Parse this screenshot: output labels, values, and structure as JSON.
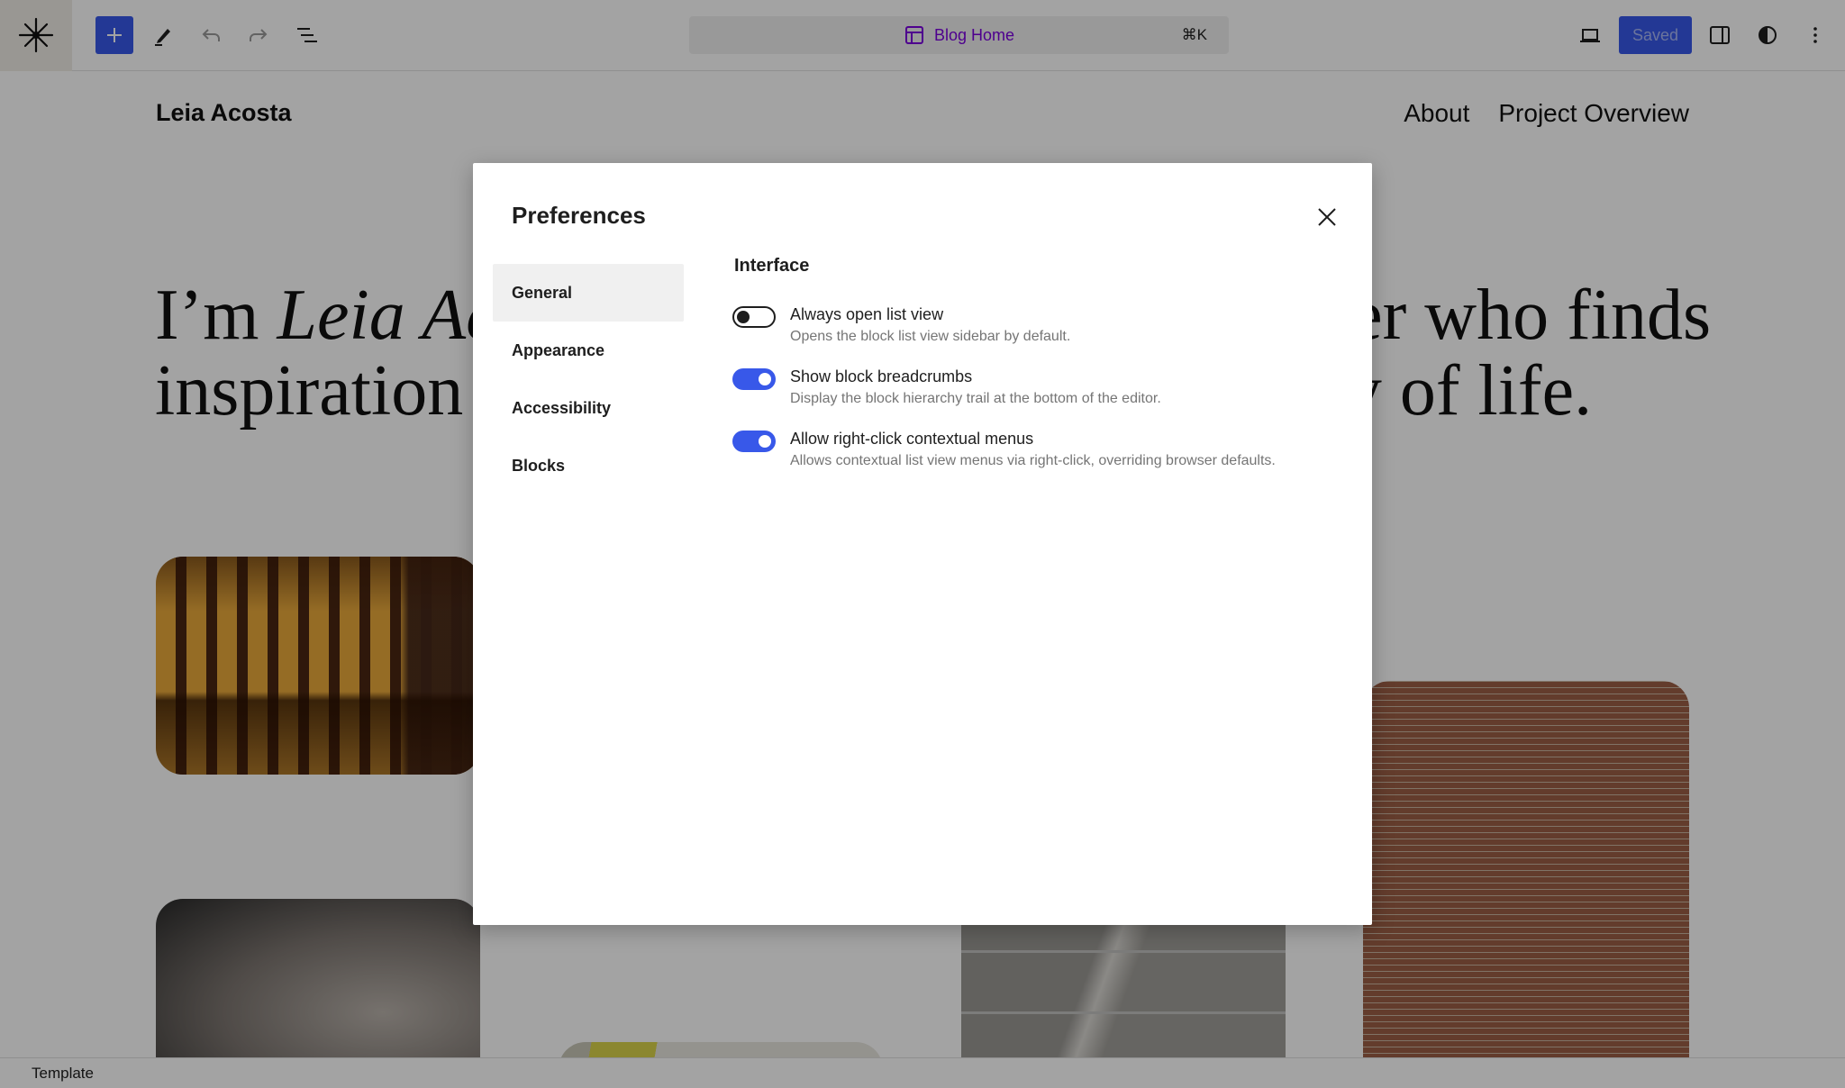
{
  "toolbar": {
    "site_icon": "wordpress-asterisk-icon",
    "add_block_icon": "plus-icon",
    "tools_icon": "pen-icon",
    "undo_icon": "undo-icon",
    "redo_icon": "redo-icon",
    "document_overview_icon": "list-view-icon",
    "command": {
      "icon": "layout-template-icon",
      "title": "Blog Home",
      "shortcut": "⌘K"
    },
    "device_icon": "laptop-icon",
    "save_label": "Saved",
    "settings_icon": "sidebar-icon",
    "styles_icon": "half-circle-contrast-icon",
    "options_icon": "vertical-ellipsis-icon",
    "accent_color": "#3858e9",
    "template_color": "#7a00df"
  },
  "page": {
    "site_title": "Leia Acosta",
    "nav": [
      "About",
      "Project Overview"
    ],
    "hero": {
      "line1_prefix": "I’m ",
      "line1_italic": "Leia Acosta",
      "line1_suffix": ", a passionate photographer who finds",
      "line2": "inspiration in capturing the fleeting beauty of life."
    }
  },
  "statusbar": {
    "label": "Template"
  },
  "preferences": {
    "title": "Preferences",
    "close_icon": "close-icon",
    "tabs": [
      {
        "label": "General",
        "active": true
      },
      {
        "label": "Appearance",
        "active": false
      },
      {
        "label": "Accessibility",
        "active": false
      },
      {
        "label": "Blocks",
        "active": false
      }
    ],
    "section_title": "Interface",
    "options": [
      {
        "label": "Always open list view",
        "help": "Opens the block list view sidebar by default.",
        "enabled": false
      },
      {
        "label": "Show block breadcrumbs",
        "help": "Display the block hierarchy trail at the bottom of the editor.",
        "enabled": true
      },
      {
        "label": "Allow right-click contextual menus",
        "help": "Allows contextual list view menus via right-click, overriding browser defaults.",
        "enabled": true
      }
    ]
  }
}
